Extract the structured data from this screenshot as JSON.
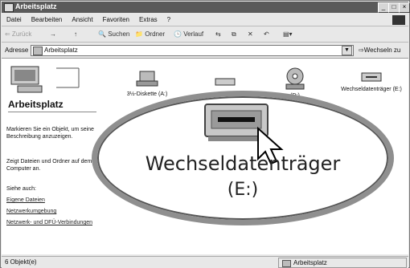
{
  "window": {
    "title": "Arbeitsplatz",
    "controls": [
      "_",
      "□",
      "×"
    ]
  },
  "menu": [
    "Datei",
    "Bearbeiten",
    "Ansicht",
    "Favoriten",
    "Extras",
    "?"
  ],
  "toolbar": {
    "back": "⇐ Zurück",
    "forward": "→",
    "up": "↑",
    "search": "Suchen",
    "folders": "Ordner",
    "history": "Verlauf",
    "view": "▤▾"
  },
  "address": {
    "label": "Adresse",
    "value": "Arbeitsplatz",
    "go": "Wechseln zu"
  },
  "left_pane": {
    "title": "Arbeitsplatz",
    "description": "Markieren Sie ein Objekt, um seine Beschreibung anzuzeigen.",
    "info": "Zeigt Dateien und Ordner auf dem Computer an.",
    "see_also_label": "Siehe auch:",
    "links": [
      "Eigene Dateien",
      "Netzwerkumgebung",
      "Netzwerk- und DFÜ-Verbindungen"
    ]
  },
  "items": [
    {
      "label": "3½-Diskette (A:)",
      "icon": "floppy-drive-icon"
    },
    {
      "label": "",
      "icon": "hard-drive-icon"
    },
    {
      "label": "(D:)",
      "icon": "cd-drive-icon"
    },
    {
      "label": "Wechseldatenträger (E:)",
      "icon": "removable-drive-icon"
    }
  ],
  "zoom": {
    "line1": "Wechseldatenträger",
    "line2": "(E:)"
  },
  "status": {
    "left": "6 Objekt(e)",
    "right": "Arbeitsplatz"
  }
}
